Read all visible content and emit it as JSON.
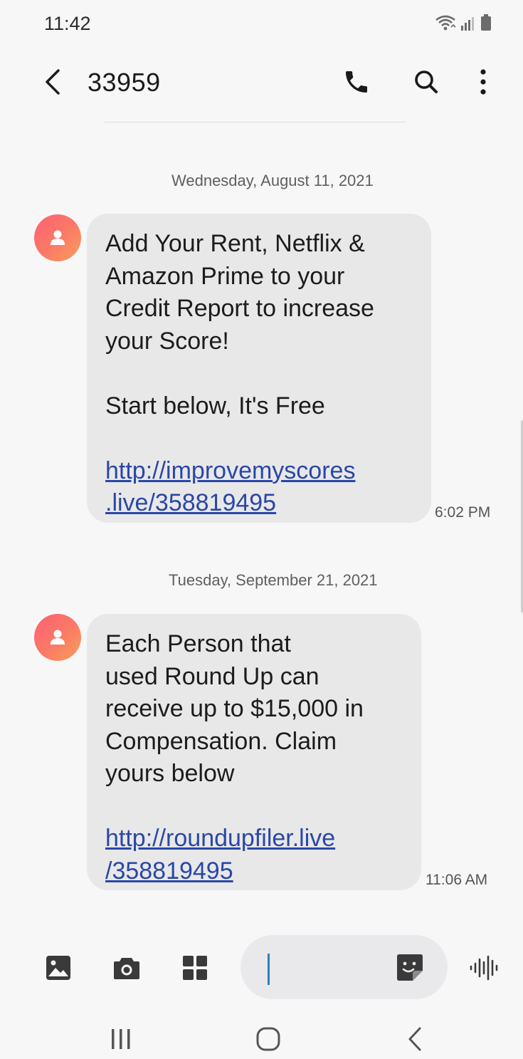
{
  "status_bar": {
    "time": "11:42"
  },
  "header": {
    "title": "33959"
  },
  "messages": [
    {
      "date": "Wednesday, August 11, 2021",
      "lines_1": [
        "Add Your Rent, Netflix &",
        "Amazon Prime to your",
        "Credit Report to increase",
        "your Score!"
      ],
      "line_2": "Start below, It's Free",
      "link_lines": [
        "http://improvemyscores",
        ".live/358819495"
      ],
      "time": "6:02 PM"
    },
    {
      "date": "Tuesday, September 21, 2021",
      "lines_1": [
        "Each Person that",
        "used Round Up can",
        "receive up to $15,000 in",
        "Compensation. Claim",
        "yours below"
      ],
      "link_lines": [
        "http://roundupfiler.live",
        "/358819495"
      ],
      "time": "11:06 AM"
    }
  ],
  "composer": {
    "input_value": ""
  },
  "colors": {
    "accent": "#2f7fb5",
    "link": "#2a47a6",
    "bubble": "#e8e8e9",
    "avatar_start": "#ff5f73",
    "avatar_end": "#f7a05a"
  }
}
